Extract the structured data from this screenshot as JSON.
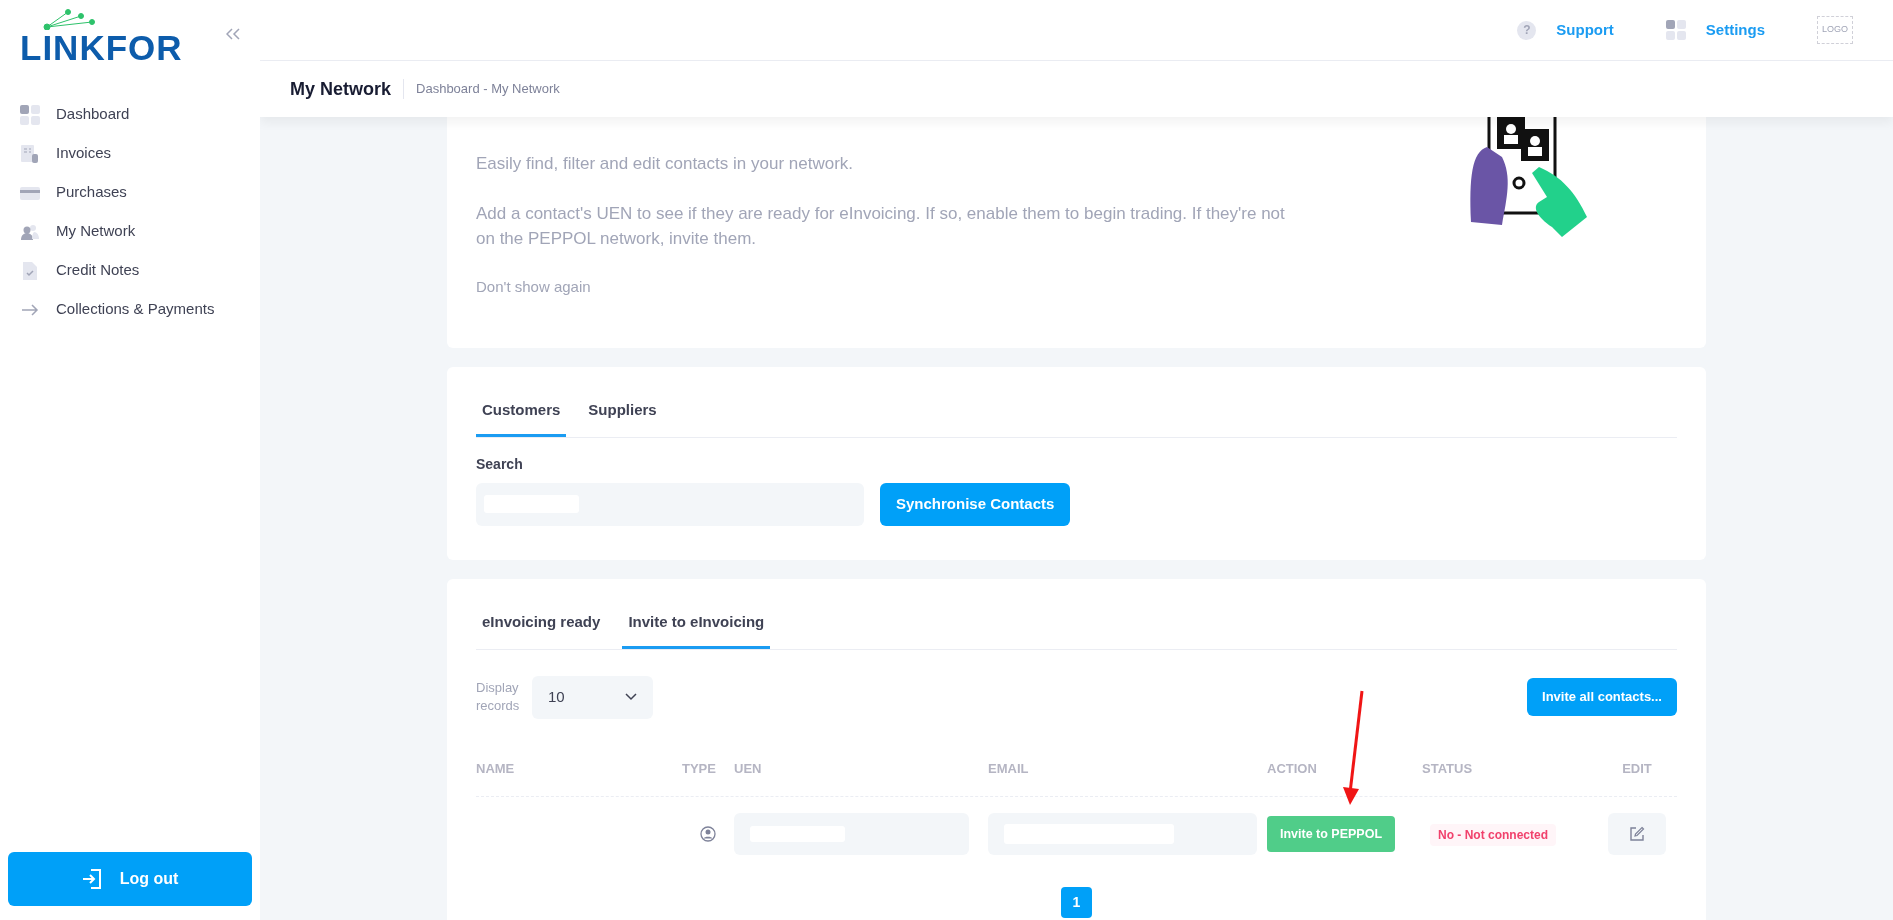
{
  "sidebar": {
    "logo": "LINKFOR",
    "items": [
      {
        "label": "Dashboard"
      },
      {
        "label": "Invoices"
      },
      {
        "label": "Purchases"
      },
      {
        "label": "My Network"
      },
      {
        "label": "Credit Notes"
      },
      {
        "label": "Collections & Payments"
      }
    ],
    "logout": "Log out"
  },
  "header": {
    "help_glyph": "?",
    "links": [
      {
        "label": "Support"
      },
      {
        "label": "Settings"
      }
    ],
    "logo_placeholder": "LOGO"
  },
  "page": {
    "title": "My Network",
    "breadcrumb": "Dashboard - My Network"
  },
  "intro": {
    "paragraphs": [
      "Easily find, filter and edit contacts in your network.",
      "Add a contact's UEN to see if they are ready for eInvoicing. If so, enable them to begin trading. If they're not on the PEPPOL network, invite them."
    ],
    "dismiss": "Don't show again"
  },
  "contacts": {
    "tabs": [
      {
        "label": "Customers",
        "selected": true
      },
      {
        "label": "Suppliers",
        "selected": false
      }
    ],
    "search": {
      "label": "Search"
    },
    "sync_button": "Synchronise Contacts"
  },
  "invites": {
    "tabs": [
      {
        "label": "eInvoicing ready",
        "selected": false
      },
      {
        "label": "Invite to eInvoicing",
        "selected": true
      }
    ],
    "display_records": {
      "label": "Display records",
      "value": "10"
    },
    "invite_all": "Invite all contacts...",
    "columns": [
      "NAME",
      "TYPE",
      "UEN",
      "EMAIL",
      "ACTION",
      "STATUS",
      "EDIT"
    ],
    "rows": [
      {
        "action": "Invite to PEPPOL",
        "status": "No - Not connected"
      }
    ],
    "pagination": [
      {
        "label": "1",
        "selected": true
      }
    ]
  }
}
